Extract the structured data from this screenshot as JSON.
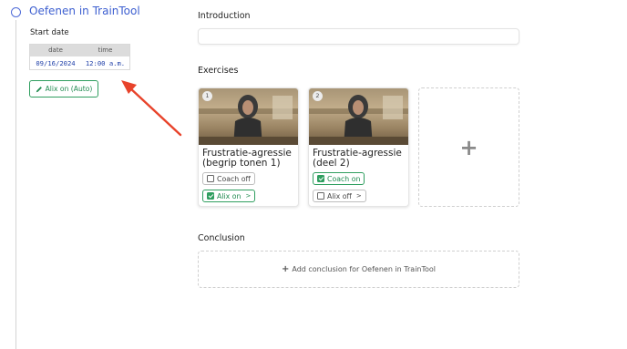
{
  "step": {
    "title": "Oefenen in TrainTool"
  },
  "start_date": {
    "label": "Start date",
    "columns": [
      "date",
      "time"
    ],
    "values": [
      "09/16/2024",
      "12:00 a.m."
    ]
  },
  "alix_auto": {
    "label": "Alix on (Auto)",
    "icon": "pencil-icon"
  },
  "introduction": {
    "title": "Introduction",
    "value": ""
  },
  "exercises": {
    "title": "Exercises",
    "items": [
      {
        "number": "1",
        "title": "Frustratie-agressie (begrip tonen 1)",
        "coach": {
          "label": "Coach off",
          "checked": false
        },
        "alix": {
          "label": "Alix on",
          "checked": true
        }
      },
      {
        "number": "2",
        "title": "Frustratie-agressie (deel 2)",
        "coach": {
          "label": "Coach on",
          "checked": true
        },
        "alix": {
          "label": "Alix off",
          "checked": false
        }
      }
    ],
    "add_icon": "plus-icon"
  },
  "conclusion": {
    "title": "Conclusion",
    "add_label": "Add conclusion for Oefenen in TrainTool"
  },
  "colors": {
    "accent": "#3d5fd0",
    "green": "#2f9e5f",
    "arrow": "#e8432b"
  }
}
